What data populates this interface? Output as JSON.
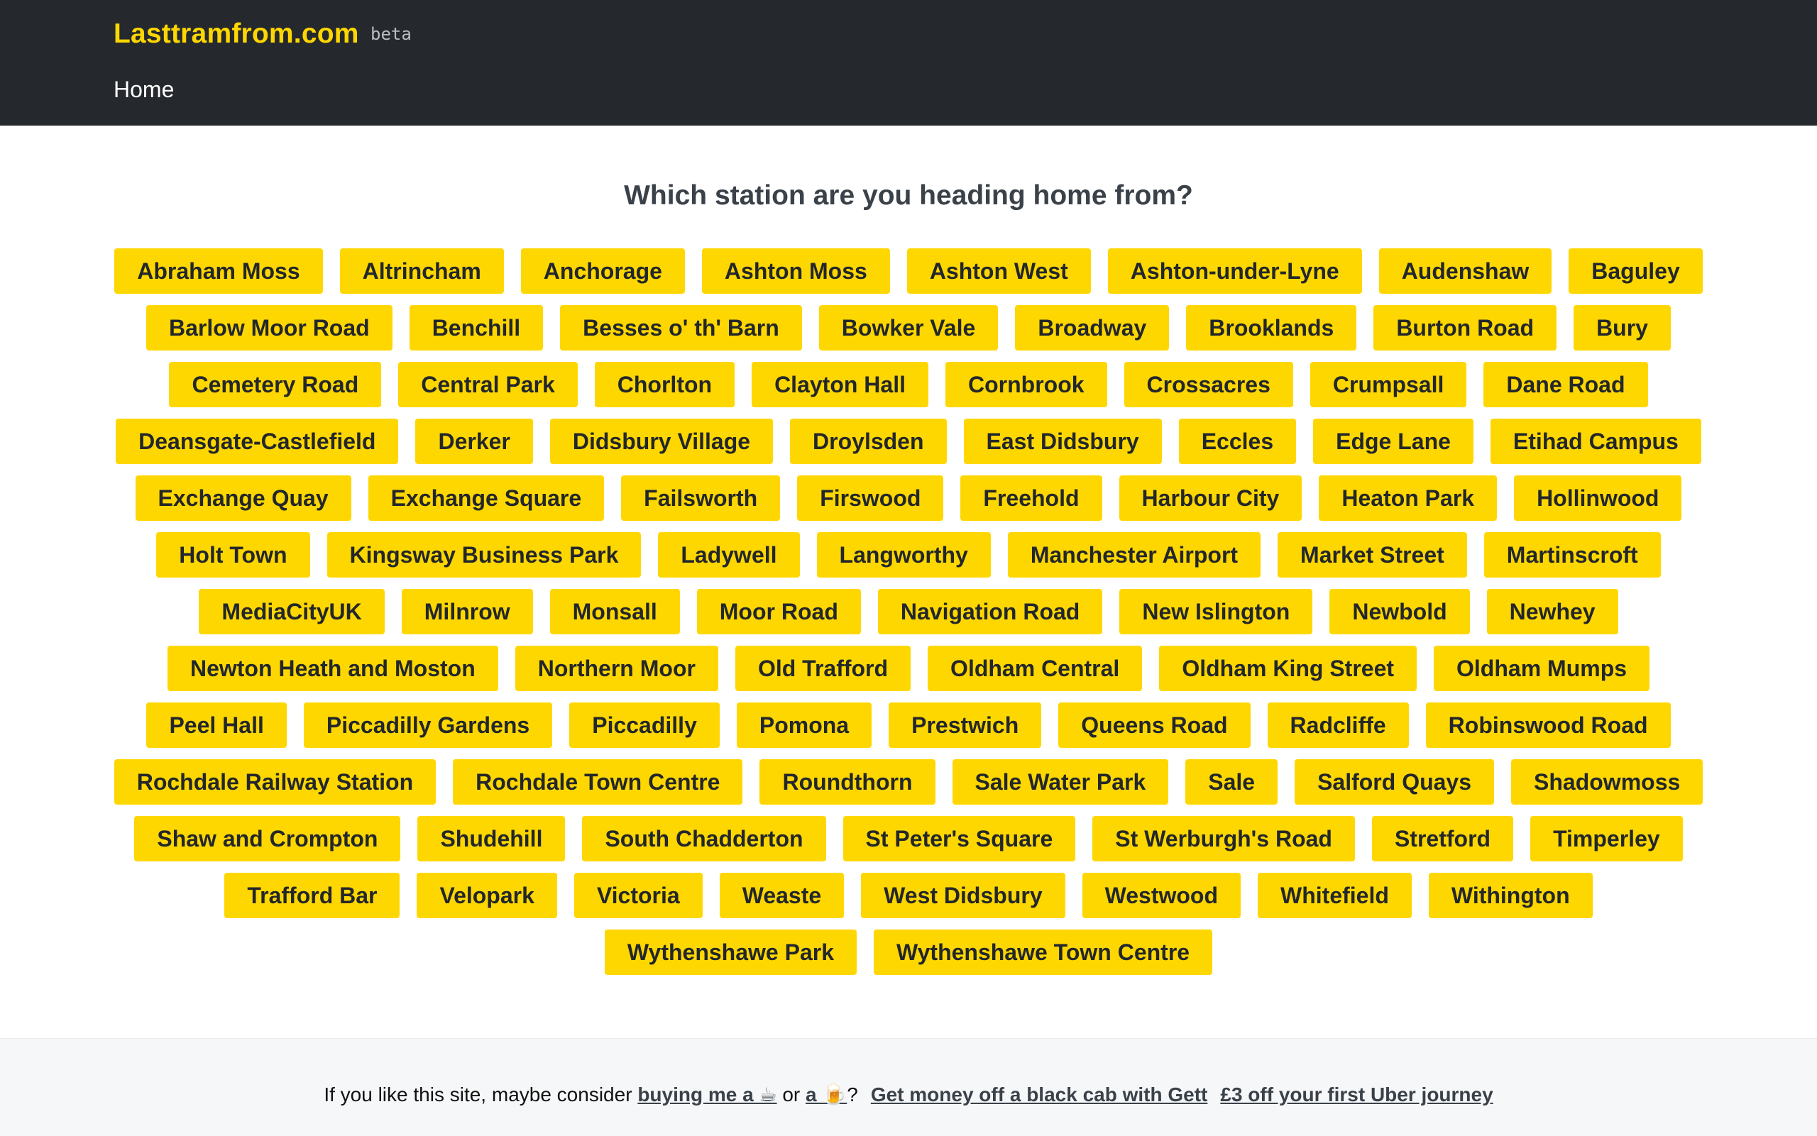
{
  "header": {
    "brand": "Lasttramfrom.com",
    "badge": "beta",
    "nav_home": "Home"
  },
  "main": {
    "heading": "Which station are you heading home from?",
    "stations": [
      "Abraham Moss",
      "Altrincham",
      "Anchorage",
      "Ashton Moss",
      "Ashton West",
      "Ashton-under-Lyne",
      "Audenshaw",
      "Baguley",
      "Barlow Moor Road",
      "Benchill",
      "Besses o' th' Barn",
      "Bowker Vale",
      "Broadway",
      "Brooklands",
      "Burton Road",
      "Bury",
      "Cemetery Road",
      "Central Park",
      "Chorlton",
      "Clayton Hall",
      "Cornbrook",
      "Crossacres",
      "Crumpsall",
      "Dane Road",
      "Deansgate-Castlefield",
      "Derker",
      "Didsbury Village",
      "Droylsden",
      "East Didsbury",
      "Eccles",
      "Edge Lane",
      "Etihad Campus",
      "Exchange Quay",
      "Exchange Square",
      "Failsworth",
      "Firswood",
      "Freehold",
      "Harbour City",
      "Heaton Park",
      "Hollinwood",
      "Holt Town",
      "Kingsway Business Park",
      "Ladywell",
      "Langworthy",
      "Manchester Airport",
      "Market Street",
      "Martinscroft",
      "MediaCityUK",
      "Milnrow",
      "Monsall",
      "Moor Road",
      "Navigation Road",
      "New Islington",
      "Newbold",
      "Newhey",
      "Newton Heath and Moston",
      "Northern Moor",
      "Old Trafford",
      "Oldham Central",
      "Oldham King Street",
      "Oldham Mumps",
      "Peel Hall",
      "Piccadilly Gardens",
      "Piccadilly",
      "Pomona",
      "Prestwich",
      "Queens Road",
      "Radcliffe",
      "Robinswood Road",
      "Rochdale Railway Station",
      "Rochdale Town Centre",
      "Roundthorn",
      "Sale Water Park",
      "Sale",
      "Salford Quays",
      "Shadowmoss",
      "Shaw and Crompton",
      "Shudehill",
      "South Chadderton",
      "St Peter's Square",
      "St Werburgh's Road",
      "Stretford",
      "Timperley",
      "Trafford Bar",
      "Velopark",
      "Victoria",
      "Weaste",
      "West Didsbury",
      "Westwood",
      "Whitefield",
      "Withington",
      "Wythenshawe Park",
      "Wythenshawe Town Centre"
    ]
  },
  "footer": {
    "intro": "If you like this site, maybe consider ",
    "buy_link": "buying me a ☕",
    "or_text": " or ",
    "a_link": "a 🍺",
    "question": "?",
    "gett_link": "Get money off a black cab with Gett",
    "uber_link": "£3 off your first Uber journey"
  },
  "colors": {
    "navbar": "#25292e",
    "brand": "#ffd700",
    "button": "#ffd700",
    "button_text": "#23272b",
    "footer_bg": "#f6f7f8"
  }
}
